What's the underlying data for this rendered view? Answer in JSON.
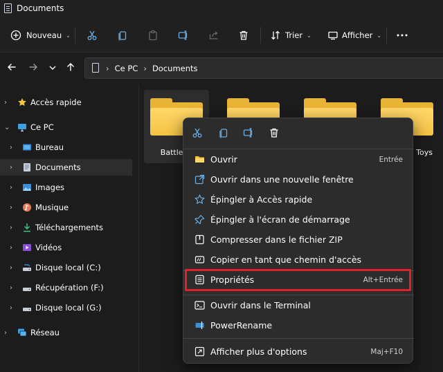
{
  "window": {
    "title": "Documents"
  },
  "toolbar": {
    "new_label": "Nouveau",
    "sort_label": "Trier",
    "view_label": "Afficher",
    "icons": [
      "plus-circle",
      "cut",
      "copy",
      "paste",
      "rename",
      "share",
      "delete",
      "sort",
      "view",
      "more"
    ]
  },
  "address": {
    "crumbs": [
      "Ce PC",
      "Documents"
    ],
    "separators": [
      "›",
      "›"
    ]
  },
  "sidebar": {
    "items": [
      {
        "label": "Accès rapide",
        "icon": "star-icon",
        "arrow": "›"
      },
      {
        "label": "Ce PC",
        "icon": "pc-icon",
        "arrow": "⌄"
      },
      {
        "label": "Bureau",
        "icon": "desktop-icon",
        "arrow": "›"
      },
      {
        "label": "Documents",
        "icon": "documents-icon",
        "arrow": "›"
      },
      {
        "label": "Images",
        "icon": "images-icon",
        "arrow": "›"
      },
      {
        "label": "Musique",
        "icon": "music-icon",
        "arrow": "›"
      },
      {
        "label": "Téléchargements",
        "icon": "download-icon",
        "arrow": "›"
      },
      {
        "label": "Vidéos",
        "icon": "video-icon",
        "arrow": "›"
      },
      {
        "label": "Disque local (C:)",
        "icon": "drive-icon",
        "arrow": "›"
      },
      {
        "label": "Récupération (F:)",
        "icon": "drive-icon",
        "arrow": "›"
      },
      {
        "label": "Disque local (G:)",
        "icon": "drive-icon",
        "arrow": "›"
      },
      {
        "label": "Réseau",
        "icon": "network-icon",
        "arrow": "›"
      }
    ]
  },
  "folders": [
    {
      "name": "Battlefie"
    },
    {
      "name": ""
    },
    {
      "name": ""
    },
    {
      "name": "Toys"
    }
  ],
  "context_menu": {
    "quick_actions": [
      "cut-icon",
      "copy-icon",
      "rename-icon",
      "delete-icon"
    ],
    "items": [
      {
        "label": "Ouvrir",
        "shortcut": "Entrée",
        "icon": "open-folder-icon"
      },
      {
        "label": "Ouvrir dans une nouvelle fenêtre",
        "shortcut": "",
        "icon": "new-window-icon"
      },
      {
        "label": "Épingler à Accès rapide",
        "shortcut": "",
        "icon": "star-outline-icon"
      },
      {
        "label": "Épingler à l'écran de démarrage",
        "shortcut": "",
        "icon": "pin-icon"
      },
      {
        "label": "Compresser dans le fichier ZIP",
        "shortcut": "",
        "icon": "zip-icon"
      },
      {
        "label": "Copier en tant que chemin d'accès",
        "shortcut": "",
        "icon": "copy-path-icon"
      },
      {
        "label": "Propriétés",
        "shortcut": "Alt+Entrée",
        "icon": "properties-icon"
      },
      {
        "label": "Ouvrir dans le Terminal",
        "shortcut": "",
        "icon": "terminal-icon"
      },
      {
        "label": "PowerRename",
        "shortcut": "",
        "icon": "powerrename-icon"
      },
      {
        "label": "Afficher plus d'options",
        "shortcut": "Maj+F10",
        "icon": "more-options-icon"
      }
    ]
  },
  "colors": {
    "background": "#1c1c1c",
    "toolbar": "#202020",
    "menu": "#2c2c2c",
    "highlight": "#e0212b",
    "folder": "#f6c445",
    "accent": "#4cc2ff"
  }
}
